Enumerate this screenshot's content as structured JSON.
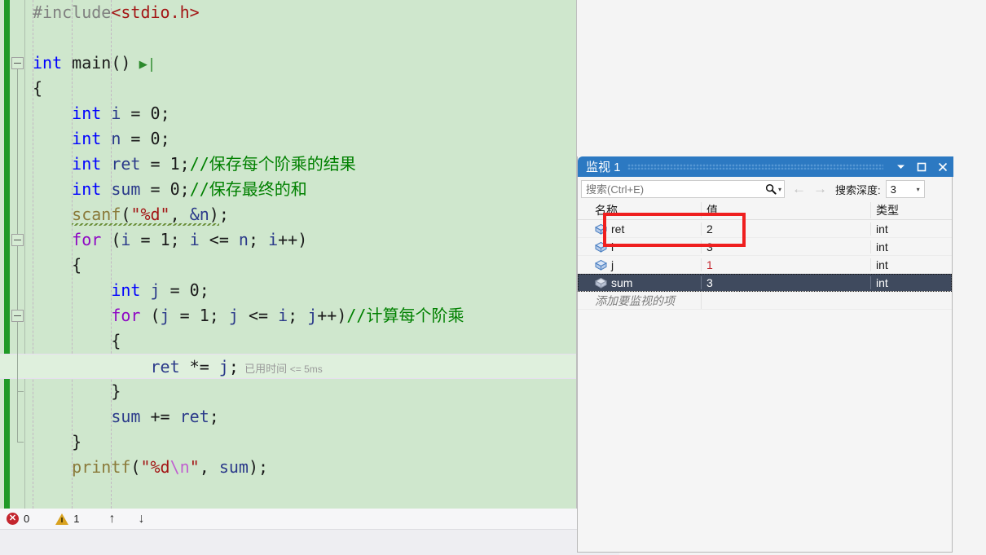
{
  "editor": {
    "lines": [
      {
        "id": "l1",
        "indent": 1,
        "segs": [
          {
            "t": "#include",
            "c": "pp"
          },
          {
            "t": "<stdio.h>",
            "c": "inc"
          }
        ]
      },
      {
        "id": "l2",
        "indent": 0,
        "segs": []
      },
      {
        "id": "l3",
        "indent": 0,
        "segs": [
          {
            "t": "int",
            "c": "kw"
          },
          {
            "t": " main()",
            "c": "plain"
          }
        ],
        "step": "▶|",
        "fold": true
      },
      {
        "id": "l4",
        "indent": 1,
        "segs": [
          {
            "t": "{",
            "c": "plain"
          }
        ]
      },
      {
        "id": "l5",
        "indent": 2,
        "segs": [
          {
            "t": "int",
            "c": "kw"
          },
          {
            "t": " ",
            "c": "plain"
          },
          {
            "t": "i",
            "c": "var"
          },
          {
            "t": " = ",
            "c": "plain"
          },
          {
            "t": "0",
            "c": "num"
          },
          {
            "t": ";",
            "c": "plain"
          }
        ]
      },
      {
        "id": "l6",
        "indent": 2,
        "segs": [
          {
            "t": "int",
            "c": "kw"
          },
          {
            "t": " ",
            "c": "plain"
          },
          {
            "t": "n",
            "c": "var"
          },
          {
            "t": " = ",
            "c": "plain"
          },
          {
            "t": "0",
            "c": "num"
          },
          {
            "t": ";",
            "c": "plain"
          }
        ]
      },
      {
        "id": "l7",
        "indent": 2,
        "segs": [
          {
            "t": "int",
            "c": "kw"
          },
          {
            "t": " ",
            "c": "plain"
          },
          {
            "t": "ret",
            "c": "var"
          },
          {
            "t": " = ",
            "c": "plain"
          },
          {
            "t": "1",
            "c": "num"
          },
          {
            "t": ";",
            "c": "plain"
          },
          {
            "t": "//保存每个阶乘的结果",
            "c": "cmt"
          }
        ]
      },
      {
        "id": "l8",
        "indent": 2,
        "segs": [
          {
            "t": "int",
            "c": "kw"
          },
          {
            "t": " ",
            "c": "plain"
          },
          {
            "t": "sum",
            "c": "var"
          },
          {
            "t": " = ",
            "c": "plain"
          },
          {
            "t": "0",
            "c": "num"
          },
          {
            "t": ";",
            "c": "plain"
          },
          {
            "t": "//保存最终的和",
            "c": "cmt"
          }
        ]
      },
      {
        "id": "l9",
        "indent": 2,
        "segs": [
          {
            "t": "scanf",
            "c": "fn squig"
          },
          {
            "t": "(",
            "c": "plain squig"
          },
          {
            "t": "\"%d\"",
            "c": "str squig"
          },
          {
            "t": ", ",
            "c": "plain squig"
          },
          {
            "t": "&n",
            "c": "var squig"
          },
          {
            "t": ")",
            "c": "plain squig"
          },
          {
            "t": ";",
            "c": "plain"
          }
        ]
      },
      {
        "id": "l10",
        "indent": 2,
        "segs": [
          {
            "t": "for",
            "c": "kw2"
          },
          {
            "t": " (",
            "c": "plain"
          },
          {
            "t": "i",
            "c": "var"
          },
          {
            "t": " = ",
            "c": "plain"
          },
          {
            "t": "1",
            "c": "num"
          },
          {
            "t": "; ",
            "c": "plain"
          },
          {
            "t": "i",
            "c": "var"
          },
          {
            "t": " <= ",
            "c": "plain"
          },
          {
            "t": "n",
            "c": "var"
          },
          {
            "t": "; ",
            "c": "plain"
          },
          {
            "t": "i",
            "c": "var"
          },
          {
            "t": "++)",
            "c": "plain"
          }
        ],
        "fold": true
      },
      {
        "id": "l11",
        "indent": 2,
        "segs": [
          {
            "t": "{",
            "c": "plain"
          }
        ]
      },
      {
        "id": "l12",
        "indent": 3,
        "segs": [
          {
            "t": "int",
            "c": "kw"
          },
          {
            "t": " ",
            "c": "plain"
          },
          {
            "t": "j",
            "c": "var"
          },
          {
            "t": " = ",
            "c": "plain"
          },
          {
            "t": "0",
            "c": "num"
          },
          {
            "t": ";",
            "c": "plain"
          }
        ]
      },
      {
        "id": "l13",
        "indent": 3,
        "segs": [
          {
            "t": "for",
            "c": "kw2"
          },
          {
            "t": " (",
            "c": "plain"
          },
          {
            "t": "j",
            "c": "var"
          },
          {
            "t": " = ",
            "c": "plain"
          },
          {
            "t": "1",
            "c": "num"
          },
          {
            "t": "; ",
            "c": "plain"
          },
          {
            "t": "j",
            "c": "var"
          },
          {
            "t": " <= ",
            "c": "plain"
          },
          {
            "t": "i",
            "c": "var"
          },
          {
            "t": "; ",
            "c": "plain"
          },
          {
            "t": "j",
            "c": "var"
          },
          {
            "t": "++)",
            "c": "plain"
          },
          {
            "t": "//计算每个阶乘",
            "c": "cmt"
          }
        ],
        "fold": true
      },
      {
        "id": "l14",
        "indent": 3,
        "segs": [
          {
            "t": "{",
            "c": "plain"
          }
        ]
      },
      {
        "id": "l15",
        "indent": 4,
        "segs": [
          {
            "t": "ret",
            "c": "var"
          },
          {
            "t": " *= ",
            "c": "plain"
          },
          {
            "t": "j",
            "c": "var"
          },
          {
            "t": ";",
            "c": "plain"
          }
        ],
        "current": true,
        "hint": "已用时间",
        "hint2": "<= 5ms"
      },
      {
        "id": "l16",
        "indent": 3,
        "segs": [
          {
            "t": "}",
            "c": "plain"
          }
        ]
      },
      {
        "id": "l17",
        "indent": 3,
        "segs": [
          {
            "t": "sum",
            "c": "var"
          },
          {
            "t": " += ",
            "c": "plain"
          },
          {
            "t": "ret",
            "c": "var"
          },
          {
            "t": ";",
            "c": "plain"
          }
        ]
      },
      {
        "id": "l18",
        "indent": 2,
        "segs": [
          {
            "t": "}",
            "c": "plain"
          }
        ]
      },
      {
        "id": "l19",
        "indent": 2,
        "segs": [
          {
            "t": "printf",
            "c": "fn"
          },
          {
            "t": "(",
            "c": "plain"
          },
          {
            "t": "\"%d",
            "c": "str"
          },
          {
            "t": "\\n",
            "c": "esc"
          },
          {
            "t": "\"",
            "c": "str"
          },
          {
            "t": ", ",
            "c": "plain"
          },
          {
            "t": "sum",
            "c": "var"
          },
          {
            "t": ");",
            "c": "plain"
          }
        ]
      }
    ]
  },
  "statusbar": {
    "error_icon": "error-circle-icon",
    "error_count": "0",
    "warning_icon": "warning-triangle-icon",
    "warning_count": "1",
    "prev_icon": "arrow-up-icon",
    "prev_glyph": "↑",
    "next_icon": "arrow-down-icon",
    "next_glyph": "↓"
  },
  "watch": {
    "title": "监视 1",
    "titlebar_buttons": [
      {
        "name": "window-menu-dropdown",
        "glyph": "▼"
      },
      {
        "name": "maximize-restore",
        "glyph": "□"
      },
      {
        "name": "close",
        "glyph": "✕"
      }
    ],
    "search": {
      "placeholder": "搜索(Ctrl+E)",
      "value": "",
      "icon": "search-magnifier-icon",
      "options_caret": "▾",
      "back_glyph": "←",
      "forward_glyph": "→",
      "depth_label": "搜索深度:",
      "depth_value": "3",
      "depth_caret": "▾"
    },
    "columns": {
      "name": "名称",
      "value": "值",
      "type": "类型"
    },
    "rows": [
      {
        "name": "ret",
        "value": "2",
        "type": "int",
        "changed": false,
        "selected": false
      },
      {
        "name": "i",
        "value": "3",
        "type": "int",
        "changed": false,
        "selected": false
      },
      {
        "name": "j",
        "value": "1",
        "type": "int",
        "changed": true,
        "selected": false
      },
      {
        "name": "sum",
        "value": "3",
        "type": "int",
        "changed": false,
        "selected": true
      }
    ],
    "add_row_text": "添加要监视的项"
  },
  "annotation": {
    "name": "red-highlight-rectangle",
    "color": "#ef1f1f"
  },
  "colors": {
    "editor_bg": "#cfe7cd",
    "current_line_bg": "#dff0dd",
    "change_bar": "#1f9a26",
    "titlebar_blue": "#2c79c2",
    "selected_row": "#3f4a5e",
    "comment_green": "#008000",
    "keyword_blue": "#0000ff",
    "string_red": "#a31515"
  }
}
